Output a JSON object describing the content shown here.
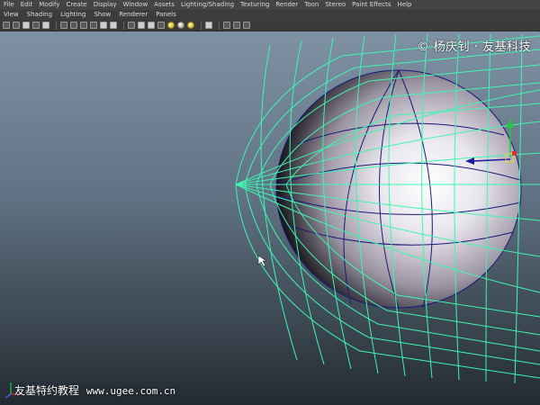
{
  "menubar": {
    "items": [
      "File",
      "Edit",
      "Modify",
      "Create",
      "Display",
      "Window",
      "Assets",
      "Lighting/Shading",
      "Texturing",
      "Render",
      "Toon",
      "Stereo",
      "Paint Effects",
      "Help"
    ]
  },
  "panel_menu": {
    "items": [
      "View",
      "Shading",
      "Lighting",
      "Show",
      "Renderer",
      "Panels"
    ]
  },
  "toolbar_icons": [
    "camera-icon",
    "film-icon",
    "bookmark-icon",
    "grid-icon",
    "resolution-gate-icon",
    "wireframe-icon",
    "smooth-shade-icon",
    "textured-icon",
    "lights-icon",
    "shadows-icon",
    "xray-icon",
    "isolate-icon",
    "sphere-yellow-icon",
    "sphere-white-icon",
    "isolate-select-icon",
    "display-options-icon"
  ],
  "watermark": {
    "top": "© 杨庆钊 · 友基科技",
    "bottom_text": "友基特约教程",
    "bottom_url": "www.ugee.com.cn"
  },
  "colors": {
    "wireframe": "#3ef5b0",
    "sphere_wire": "#1a1a7a",
    "manip_green": "#1fcc3a",
    "manip_blue": "#1a1aa0"
  }
}
